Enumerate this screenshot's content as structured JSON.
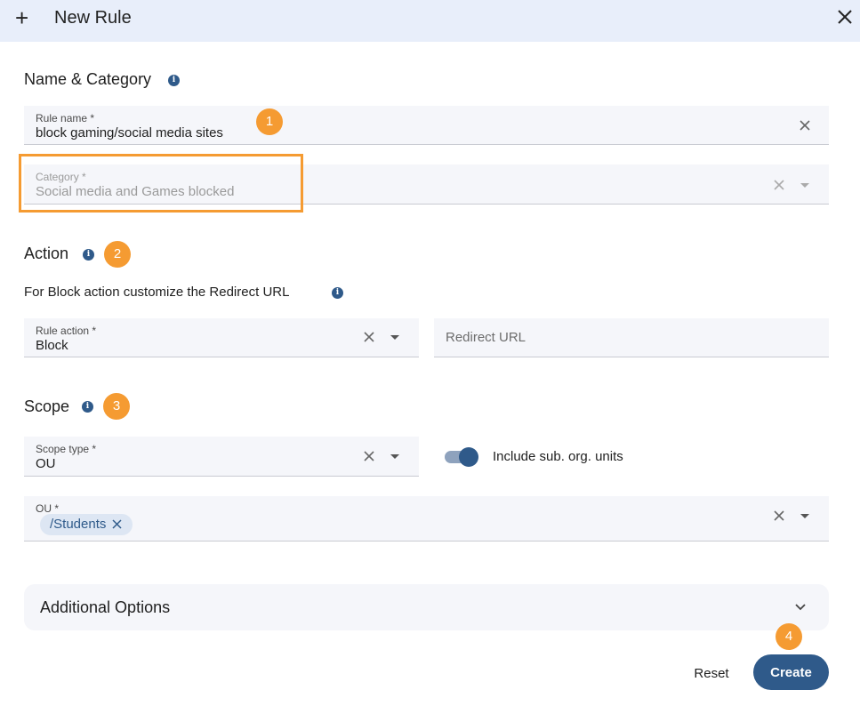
{
  "dialog": {
    "title": "New Rule",
    "plus_icon": "+"
  },
  "sections": {
    "name_category": {
      "title": "Name & Category"
    },
    "action": {
      "title": "Action",
      "subtitle": "For Block action customize the Redirect URL"
    },
    "scope": {
      "title": "Scope"
    }
  },
  "fields": {
    "rule_name": {
      "label": "Rule name *",
      "value": "block gaming/social media sites"
    },
    "category": {
      "label": "Category *",
      "value": "Social media and Games blocked"
    },
    "rule_action": {
      "label": "Rule action *",
      "value": "Block"
    },
    "redirect_url": {
      "placeholder": "Redirect URL"
    },
    "scope_type": {
      "label": "Scope type *",
      "value": "OU"
    },
    "ou": {
      "label": "OU *",
      "chips": [
        "/Students"
      ]
    }
  },
  "toggle": {
    "label": "Include sub. org. units",
    "on": true
  },
  "additional": {
    "label": "Additional Options"
  },
  "buttons": {
    "reset": "Reset",
    "create": "Create"
  },
  "badges": [
    "1",
    "2",
    "3",
    "4"
  ],
  "info_glyph": "i",
  "colors": {
    "accent": "#2f5a8a",
    "badge": "#f59b32",
    "header_bg": "#e8eefa",
    "field_bg": "#f5f6fa"
  }
}
